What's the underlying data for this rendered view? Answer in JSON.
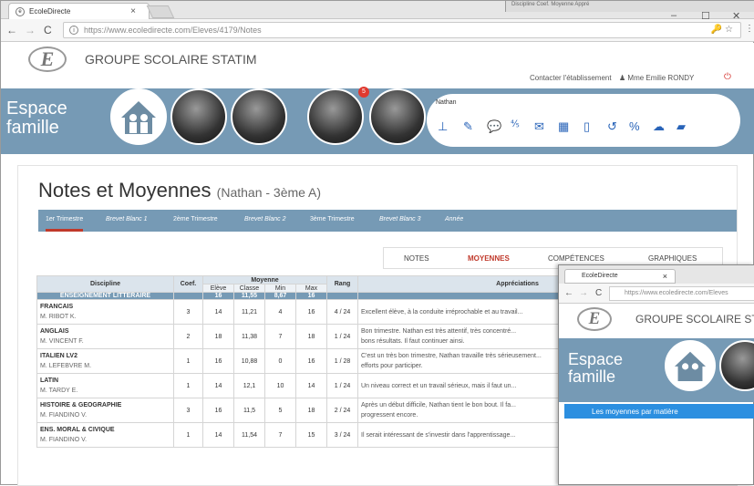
{
  "browser": {
    "tab_title": "EcoleDirecte",
    "url": "https://www.ecoledirecte.com/Eleves/4179/Notes",
    "back_icon": "arrow-left-icon",
    "other_window_cols": "Discipline        Coef.     Moyenne     Appré"
  },
  "header": {
    "logo_letter": "E",
    "school_name": "GROUPE SCOLAIRE STATIM",
    "contact_link": "Contacter l'établissement",
    "user_name": "Mme Emilie RONDY"
  },
  "banner": {
    "title_line1": "Espace",
    "title_line2": "famille",
    "notification_count": "5",
    "student_name": "Nathan"
  },
  "page": {
    "title": "Notes et Moyennes",
    "subtitle": "(Nathan - 3ème A)"
  },
  "period_tabs": [
    "1er Trimestre",
    "Brevet Blanc 1",
    "2ème Trimestre",
    "Brevet Blanc 2",
    "3ème Trimestre",
    "Brevet Blanc 3",
    "Année"
  ],
  "view_tabs": [
    "NOTES",
    "MOYENNES",
    "COMPÉTENCES",
    "GRAPHIQUES"
  ],
  "table": {
    "headers": {
      "discipline": "Discipline",
      "coef": "Coef.",
      "moyenne": "Moyenne",
      "rang": "Rang",
      "appreciation": "Appréciations",
      "eleve": "Elève",
      "classe": "Classe",
      "min": "Min",
      "max": "Max"
    },
    "section": {
      "label": "ENSEIGNEMENT LITTERAIRE",
      "eleve": "16",
      "classe": "11,55",
      "min": "8,67",
      "max": "16"
    },
    "rows": [
      {
        "subject": "FRANCAIS",
        "teacher": "M. RIBOT K.",
        "coef": "3",
        "eleve": "14",
        "classe": "11,21",
        "min": "4",
        "max": "16",
        "rang": "4 / 24",
        "appreciation": "Excellent élève, à la conduite irréprochable et au travail..."
      },
      {
        "subject": "ANGLAIS",
        "teacher": "M. VINCENT F.",
        "coef": "2",
        "eleve": "18",
        "classe": "11,38",
        "min": "7",
        "max": "18",
        "rang": "1 / 24",
        "appreciation": "Bon trimestre. Nathan est très attentif, très concentré...",
        "appreciation2": "bons résultats. Il faut continuer ainsi."
      },
      {
        "subject": "ITALIEN LV2",
        "teacher": "M. LEFEBVRE M.",
        "coef": "1",
        "eleve": "16",
        "classe": "10,88",
        "min": "0",
        "max": "16",
        "rang": "1 / 28",
        "appreciation": "C'est un très bon trimestre, Nathan travaille très sérieusement...",
        "appreciation2": "efforts pour participer."
      },
      {
        "subject": "LATIN",
        "teacher": "M. TARDY E.",
        "coef": "1",
        "eleve": "14",
        "classe": "12,1",
        "min": "10",
        "max": "14",
        "rang": "1 / 24",
        "appreciation": "Un niveau correct et un travail sérieux, mais il faut un..."
      },
      {
        "subject": "HISTOIRE & GEOGRAPHIE",
        "teacher": "M. FIANDINO V.",
        "coef": "3",
        "eleve": "16",
        "classe": "11,5",
        "min": "5",
        "max": "18",
        "rang": "2 / 24",
        "appreciation": "Après un début difficile, Nathan tient le bon bout. Il fa...",
        "appreciation2": "progressent encore."
      },
      {
        "subject": "ENS. MORAL & CIVIQUE",
        "teacher": "M. FIANDINO V.",
        "coef": "1",
        "eleve": "14",
        "classe": "11,54",
        "min": "7",
        "max": "15",
        "rang": "3 / 24",
        "appreciation": "Il serait intéressant de s'investir dans l'apprentissage..."
      }
    ]
  },
  "second_window": {
    "tab_title": "EcoleDirecte",
    "url": "https://www.ecoledirecte.com/Eleves",
    "school_name": "GROUPE SCOLAIRE STATIM",
    "title_line1": "Espace",
    "title_line2": "famille",
    "section_label": "Les moyennes par matière"
  }
}
